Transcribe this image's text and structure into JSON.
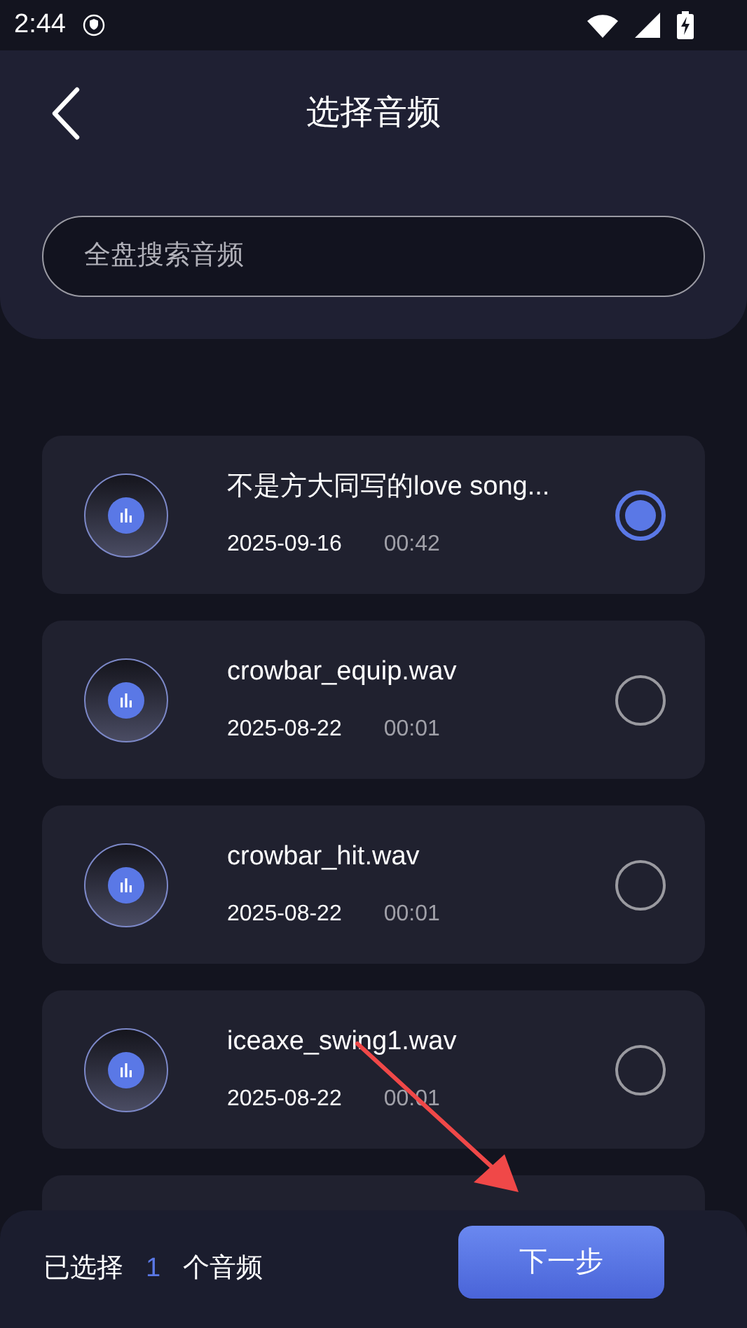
{
  "status_bar": {
    "time": "2:44"
  },
  "header": {
    "title": "选择音频"
  },
  "search": {
    "placeholder": "全盘搜索音频"
  },
  "items": [
    {
      "name": "不是方大同写的love song...",
      "date": "2025-09-16",
      "duration": "00:42",
      "selected": true
    },
    {
      "name": "crowbar_equip.wav",
      "date": "2025-08-22",
      "duration": "00:01",
      "selected": false
    },
    {
      "name": "crowbar_hit.wav",
      "date": "2025-08-22",
      "duration": "00:01",
      "selected": false
    },
    {
      "name": "iceaxe_swing1.wav",
      "date": "2025-08-22",
      "duration": "00:01",
      "selected": false
    }
  ],
  "bottom_bar": {
    "prefix": "已选择",
    "count": "1",
    "suffix": "个音频",
    "button": "下一步"
  }
}
